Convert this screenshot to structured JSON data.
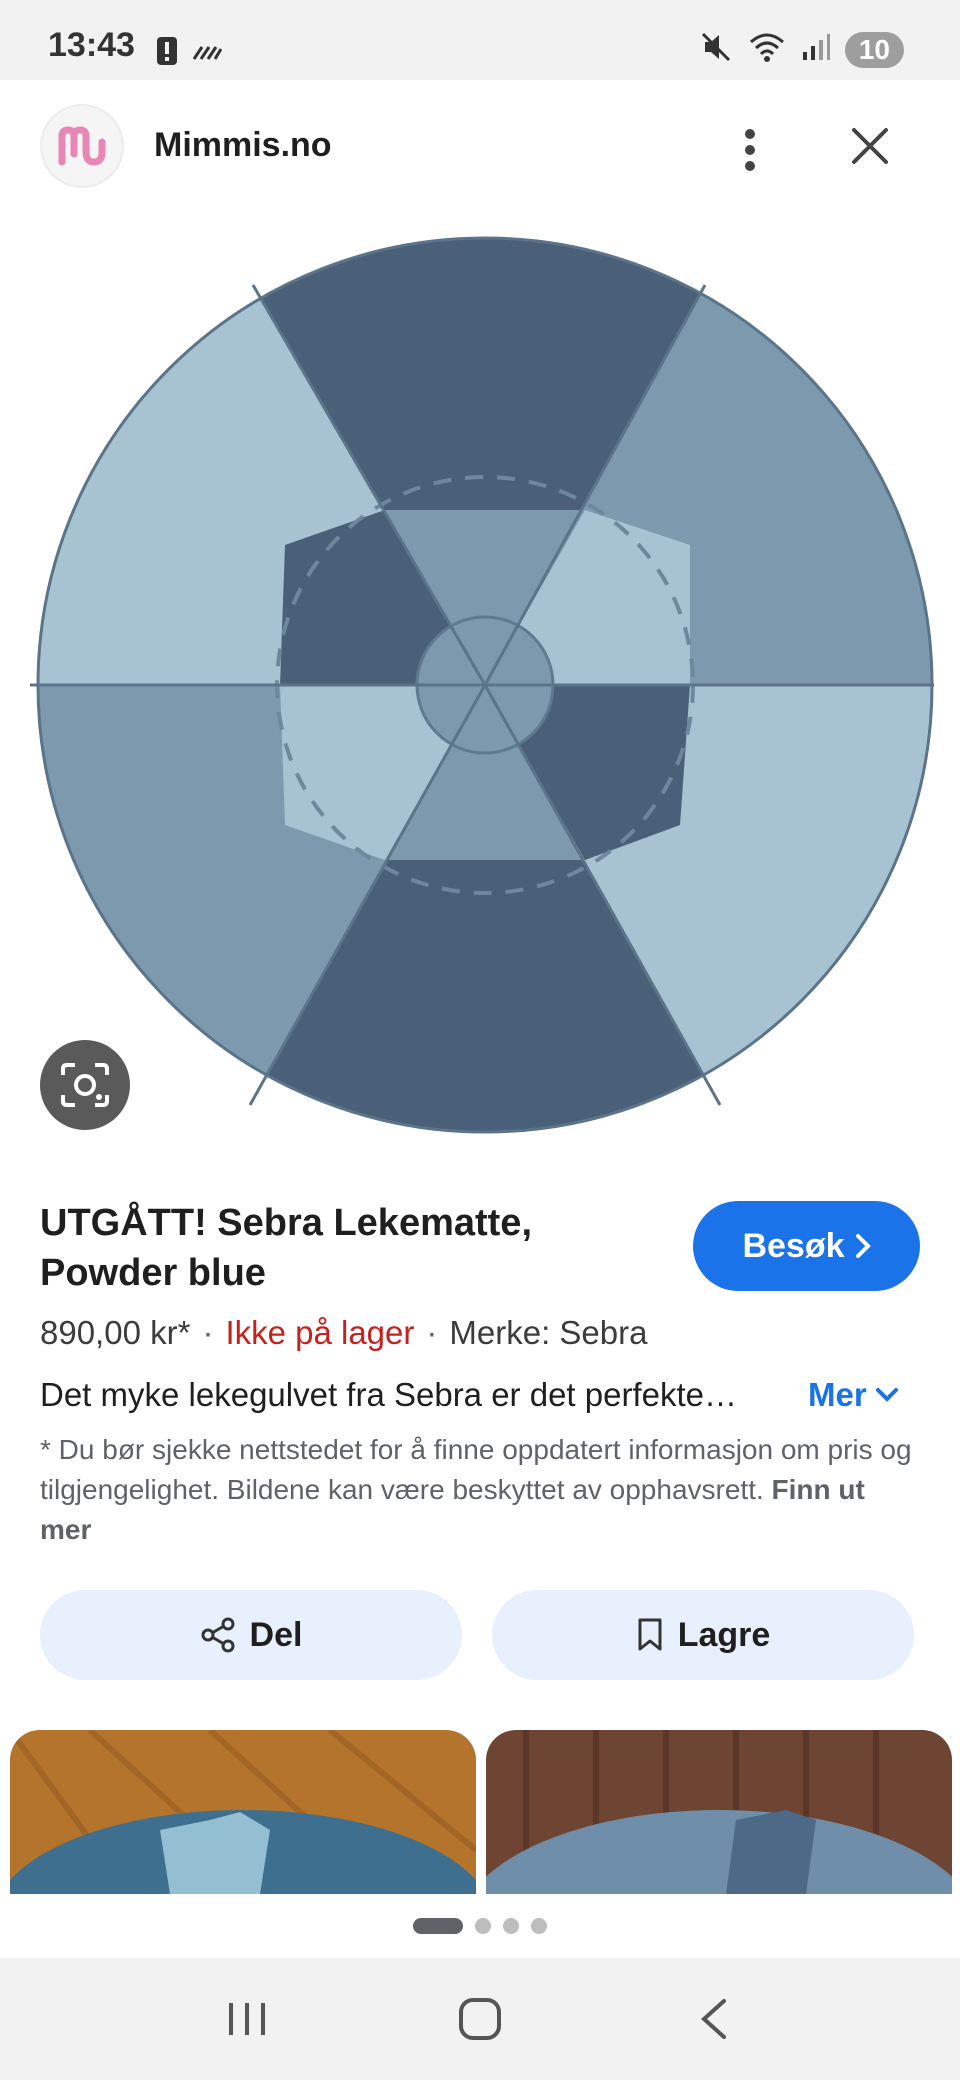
{
  "status_bar": {
    "time": "13:43",
    "battery": "10"
  },
  "header": {
    "site_name": "Mimmis.no",
    "logo_letter": "m"
  },
  "product": {
    "title": "UTGÅTT! Sebra Lekematte, Powder blue",
    "visit_label": "Besøk",
    "price": "890,00 kr*",
    "stock": "Ikke på lager",
    "brand": "Merke: Sebra",
    "description": "Det myke lekegulvet fra Sebra er det perfekte…",
    "more_label": "Mer",
    "disclaimer": "* Du bør sjekke nettstedet for å finne oppdatert informasjon om pris og tilgjengelighet. Bildene kan være beskyttet av opphavsrett.",
    "learn_more": "Finn ut mer"
  },
  "actions": {
    "share_label": "Del",
    "save_label": "Lagre"
  },
  "pagination": {
    "total": 4,
    "active": 1
  },
  "colors": {
    "accent": "#1a73e8",
    "out_of_stock": "#c5221f",
    "pill_bg": "#e8f0fe",
    "mat_dark": "#4a6079",
    "mat_mid": "#7d99ad",
    "mat_light": "#a7c2d0"
  },
  "icons": {
    "status": [
      "alert-icon",
      "data-icon",
      "mute-icon",
      "wifi-icon",
      "signal-icon"
    ],
    "header": [
      "more-vert-icon",
      "close-icon"
    ],
    "image": [
      "lens-icon"
    ],
    "actions": [
      "share-icon",
      "bookmark-icon"
    ],
    "nav": [
      "recents-icon",
      "home-icon",
      "back-icon"
    ]
  }
}
